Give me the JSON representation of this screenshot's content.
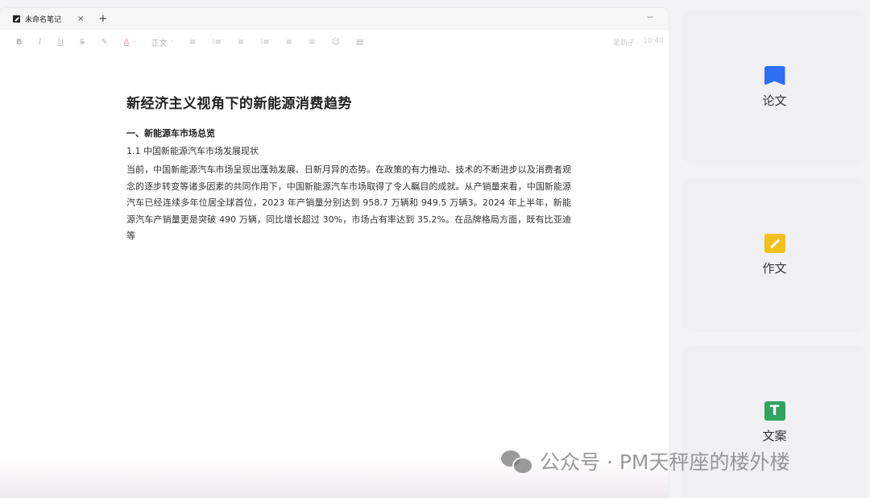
{
  "tab": {
    "title": "未命名笔记",
    "close": "×",
    "add": "+"
  },
  "window": {
    "minimize": "−"
  },
  "toolbar": {
    "bold": "B",
    "italic": "I",
    "underline": "U",
    "strike": "S",
    "highlight": "✎",
    "font_color": "A",
    "font_color_caret": "·",
    "paragraph_style": "正文",
    "paragraph_caret": "·",
    "align": "≡",
    "list1": "⁝≡",
    "list2": "≡",
    "list3": "⁝≡",
    "indent": "≡",
    "outdent": "≡",
    "emoji": "☺",
    "comment": "▤",
    "right_a": "笔新子",
    "right_b": "10:40"
  },
  "doc": {
    "title": "新经济主义视角下的新能源消费趋势",
    "heading1": "一、新能源车市场总览",
    "heading2": "1.1 中国新能源汽车市场发展现状",
    "paragraph": "当前，中国新能源汽车市场呈现出蓬勃发展、日新月异的态势。在政策的有力推动、技术的不断进步以及消费者观念的逐步转变等诸多因素的共同作用下，中国新能源汽车市场取得了令人瞩目的成就。从产销量来看，中国新能源汽车已经连续多年位居全球首位，2023 年产销量分别达到 958.7 万辆和 949.5 万辆3。2024 年上半年，新能源汽车产销量更是突破 490 万辆，同比增长超过 30%，市场占有率达到 35.2%。在品牌格局方面，既有比亚迪等"
  },
  "panel": {
    "cards": [
      {
        "label": "论文",
        "icon": "paper-icon"
      },
      {
        "label": "作文",
        "icon": "essay-icon"
      },
      {
        "label": "文案",
        "icon": "copywriting-icon"
      }
    ]
  },
  "watermark": {
    "text": "公众号 · PM天秤座的楼外楼"
  },
  "colors": {
    "paper": "#2f6df2",
    "essay": "#f4c019",
    "copy": "#2fa360"
  }
}
